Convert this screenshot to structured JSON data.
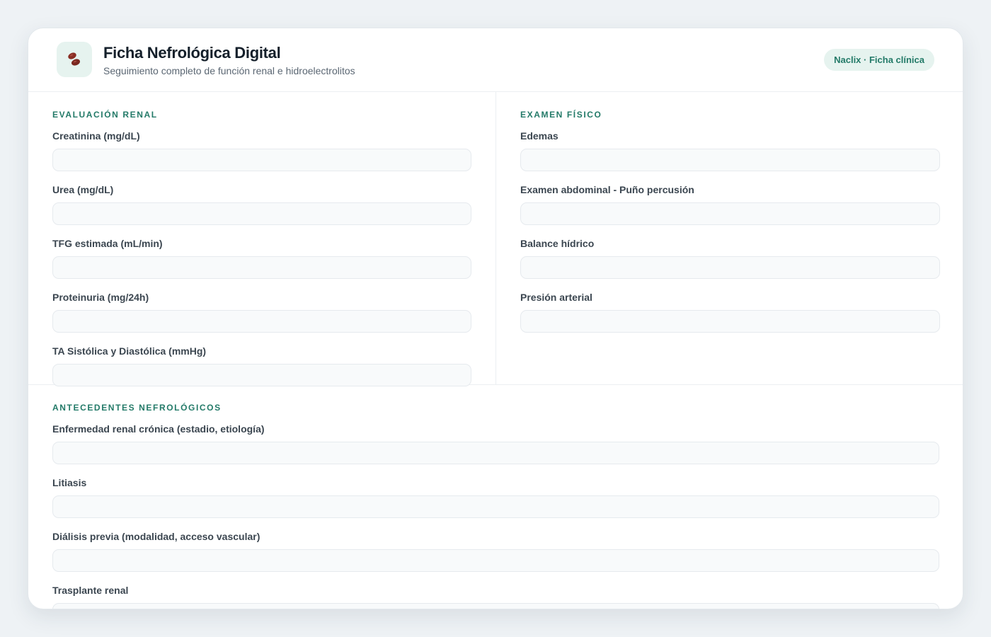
{
  "header": {
    "title": "Ficha Nefrológica Digital",
    "subtitle": "Seguimiento completo de función renal e hidroelectrolitos",
    "badge": "Naclix · Ficha clínica",
    "icon": "kidney-beans-icon"
  },
  "sections": {
    "renal": {
      "title": "Evaluación Renal",
      "fields": [
        {
          "label": "Creatinina (mg/dL)",
          "value": ""
        },
        {
          "label": "Urea (mg/dL)",
          "value": ""
        },
        {
          "label": "TFG estimada (mL/min)",
          "value": ""
        },
        {
          "label": "Proteinuria (mg/24h)",
          "value": ""
        },
        {
          "label": "TA Sistólica y Diastólica (mmHg)",
          "value": ""
        }
      ]
    },
    "exam": {
      "title": "Examen Físico",
      "fields": [
        {
          "label": "Edemas",
          "value": ""
        },
        {
          "label": "Examen abdominal - Puño percusión",
          "value": ""
        },
        {
          "label": "Balance hídrico",
          "value": ""
        },
        {
          "label": "Presión arterial",
          "value": ""
        }
      ]
    },
    "history": {
      "title": "Antecedentes Nefrológicos",
      "fields": [
        {
          "label": "Enfermedad renal crónica (estadio, etiología)",
          "value": ""
        },
        {
          "label": "Litiasis",
          "value": ""
        },
        {
          "label": "Diálisis previa (modalidad, acceso vascular)",
          "value": ""
        },
        {
          "label": "Trasplante renal",
          "value": ""
        }
      ]
    }
  },
  "colors": {
    "accent": "#237a68",
    "accent_bg": "#e6f3ef",
    "background": "#eef2f5"
  }
}
